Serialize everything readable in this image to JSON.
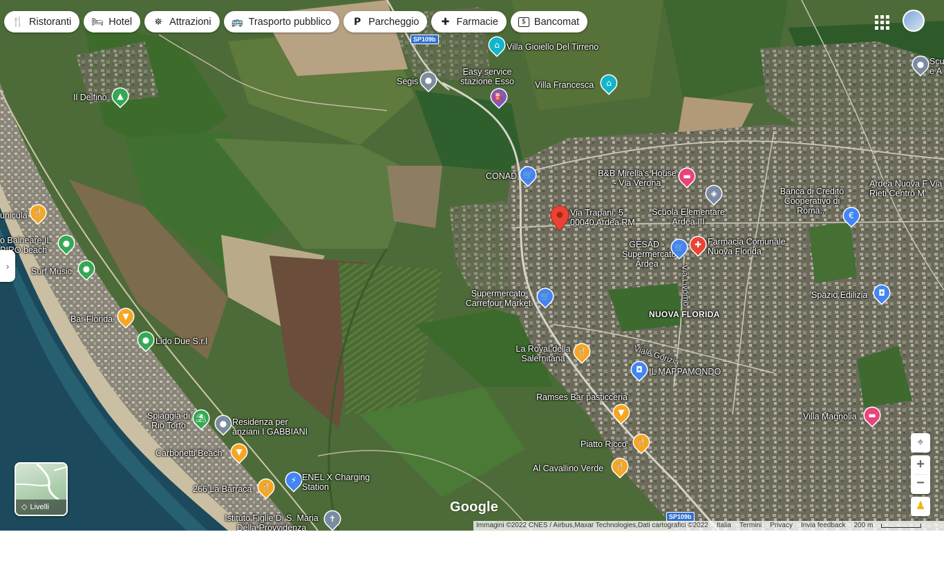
{
  "chips": [
    {
      "icon": "🍴",
      "label": "Ristoranti",
      "name": "chip-ristoranti"
    },
    {
      "icon": "🛏",
      "label": "Hotel",
      "name": "chip-hotel"
    },
    {
      "icon": "⛯",
      "label": "Attrazioni",
      "name": "chip-attrazioni"
    },
    {
      "icon": "🚌",
      "label": "Trasporto pubblico",
      "name": "chip-trasporto-pubblico"
    },
    {
      "icon": "P",
      "label": "Parcheggio",
      "name": "chip-parcheggio"
    },
    {
      "icon": "✚",
      "label": "Farmacie",
      "name": "chip-farmacie"
    },
    {
      "icon": "$",
      "label": "Bancomat",
      "name": "chip-bancomat"
    }
  ],
  "selected_place": {
    "line1": "Via Trapani, 5",
    "line2": "00040 Ardea RM"
  },
  "places": {
    "villa_gioiello": "Villa Gioiello Del Tirreno",
    "easy_service": "Easy service stazione Esso",
    "villa_francesca": "Villa Francesca",
    "segis": "Segis",
    "il_delfino": "Il Delfino",
    "conad": "CONAD",
    "bb_mirella": "B&B Mirella's House - Via Verona",
    "scuola_elementare": "Scuola Elementare Ardea III",
    "banca_credito": "Banca di Credito Cooperativo di Roma...",
    "ardea_nuova": "Ardea Nuova F Via Rieti Centro M",
    "scu": "Scu e A",
    "gesad": "GESAD - Supermercato Ardea",
    "farmacia_comunale": "Farmacia Comunale Nuova Florida",
    "supermercato_carrefour": "Supermercato Carrefour Market",
    "spazio_edilizia": "Spazio Edilizia",
    "nuova_florida": "NUOVA FLORIDA",
    "la_royal": "La Royal della Salernitana",
    "il_mappamondo": "IL MAPPAMONDO",
    "ramses_bar": "Ramses Bar pasticceria",
    "villa_magnolia": "Villa Magnolia",
    "piatto_ricco": "Piatto Ricco",
    "al_cavallino": "Al Cavallino Verde",
    "funicula": "unicula",
    "balneare": "o Balneare IL PIRO beach",
    "surf_music": "Surf Music",
    "bar_florida": "Bar Florida",
    "lido_due": "Lido Due S.r.l",
    "spiaggia_rio_torto": "Spiaggia di Rio Torto",
    "residenza_gabbiani": "Residenza per anziani I GABBIANI",
    "carbonetti_beach": "Carbonetti Beach",
    "enel_x": "ENEL X Charging Station",
    "la_barraca": "266 La Barraca",
    "istituto_figlie": "Istituto Figlie Di S. Maria Della Provvidenza"
  },
  "roads": {
    "via_livorno": "Via Livorno",
    "viale_gorizia": "Viale Gorizia",
    "sp109b": "SP109b"
  },
  "layers_label": "Livelli",
  "google_logo": "Google",
  "attribution": {
    "imagery": "Immagini ©2022 CNES / Airbus,Maxar Technologies,Dati cartografici ©2022",
    "country": "Italia",
    "terms": "Termini",
    "privacy": "Privacy",
    "feedback": "Invia feedback",
    "scale": "200 m"
  },
  "colors": {
    "restaurant_pin": "#f5a623",
    "shopping_pin": "#4285f4",
    "hotel_pin": "#e8447b",
    "attraction_pin": "#12b5cb",
    "park_pin": "#34a853",
    "generic_pin": "#7b8ba1",
    "selected_pin": "#ea4335"
  }
}
